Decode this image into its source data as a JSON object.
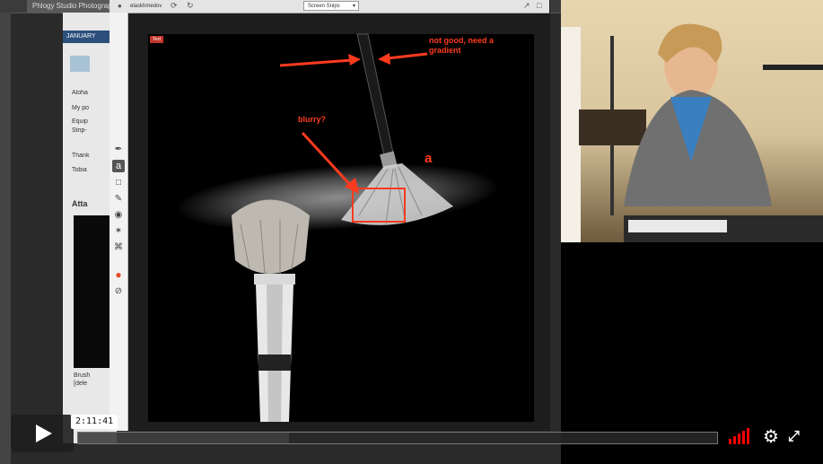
{
  "background_browser": {
    "tab_title": "Phlogy Studio Photography Sc",
    "page_header": "JANUARY",
    "lines": [
      "Aloha",
      "My po",
      "Equip",
      "Strip-",
      "Thank",
      "Tobia"
    ],
    "section_title": "Atta",
    "brush_lines": [
      "Brush",
      "[dele"
    ]
  },
  "editor": {
    "user_label": "elaskhmedov",
    "dropdown_label": "Screen Snips",
    "canvas_chip": "Text",
    "tools": [
      "pen-icon",
      "text-icon",
      "rectangle-icon",
      "marker-icon",
      "blur-icon",
      "magic-icon",
      "crop-icon",
      "color-icon",
      "slash-icon"
    ],
    "tool_text_glyph": "a"
  },
  "annotations": {
    "note_top": "not good,  need a gradient",
    "note_blurry": "blurry?",
    "note_a": "a",
    "color": "#ff3b1f"
  },
  "player": {
    "time": "2:11:41",
    "played_fraction": 0.33,
    "accent": "#ff0000"
  }
}
